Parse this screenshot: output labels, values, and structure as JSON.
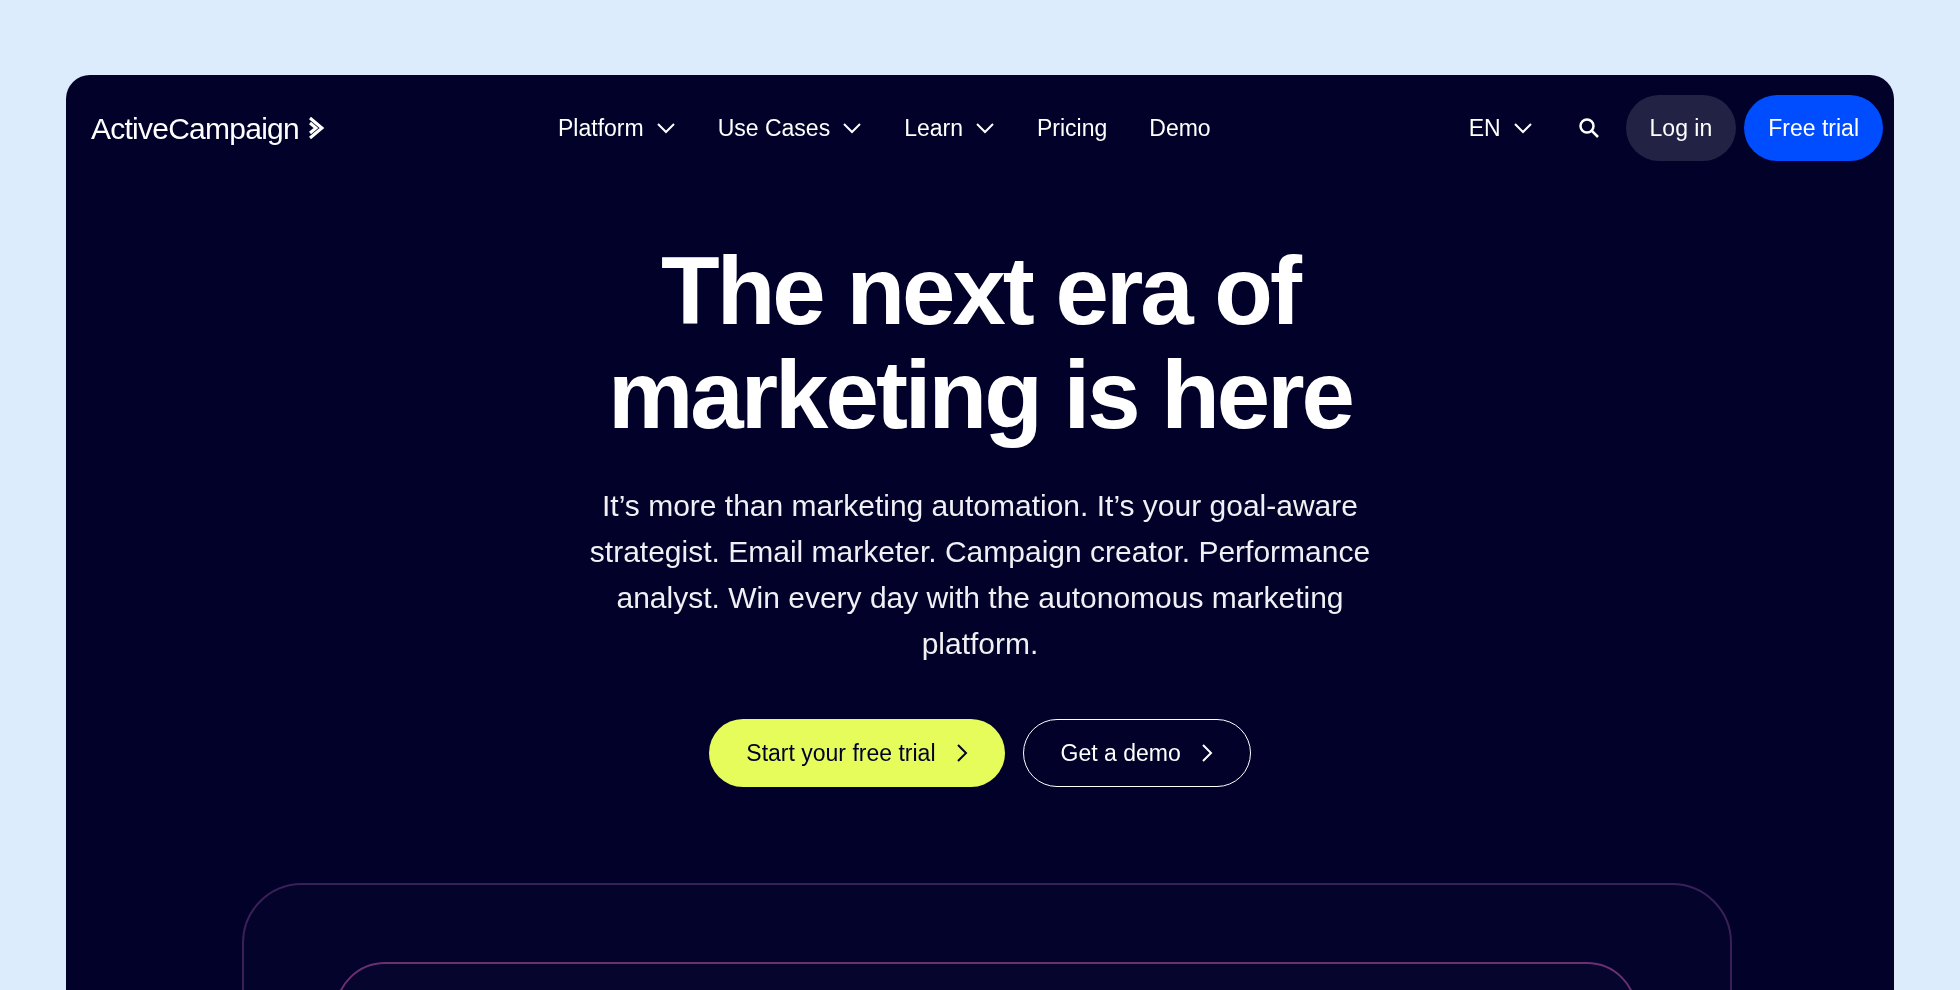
{
  "logo": {
    "text": "ActiveCampaign"
  },
  "nav": [
    {
      "label": "Platform",
      "dropdown": true
    },
    {
      "label": "Use Cases",
      "dropdown": true
    },
    {
      "label": "Learn",
      "dropdown": true
    },
    {
      "label": "Pricing",
      "dropdown": false
    },
    {
      "label": "Demo",
      "dropdown": false
    }
  ],
  "language": {
    "label": "EN"
  },
  "login": "Log in",
  "free_trial": "Free trial",
  "hero": {
    "title_lines": [
      "The next era of",
      "marketing is here"
    ],
    "text": "It’s more than marketing automation. It’s your goal-aware strategist. Email marketer. Campaign creator. Performance analyst. Win every day with the autonomous marketing platform.",
    "primary": "Start your free trial",
    "secondary": "Get a demo"
  }
}
